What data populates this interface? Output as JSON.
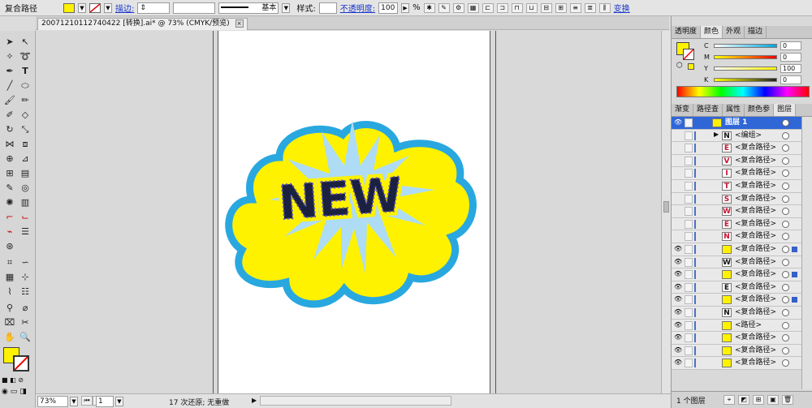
{
  "controlbar": {
    "selection_type": "复合路径",
    "stroke_label": "描边:",
    "stroke_profile": "基本",
    "style_label": "样式:",
    "opacity_label": "不透明度:",
    "opacity_value": "100",
    "opacity_unit": "%",
    "transform_label": "变换",
    "fill_color": "#fff200"
  },
  "document": {
    "tab_title": "20071210112740422 [转换].ai* @ 73% (CMYK/预览)",
    "close_glyph": "×"
  },
  "artwork": {
    "text": "NEW",
    "cloud_fill": "#fff200",
    "cloud_stroke": "#29a8e0",
    "burst_fill": "#aedcf4"
  },
  "status": {
    "zoom": "73%",
    "page": "1",
    "message": "17 次还原; 无重做"
  },
  "color_panel": {
    "tabs": [
      "透明度",
      "颜色",
      "外观",
      "描边"
    ],
    "channels": [
      {
        "label": "C",
        "value": "0"
      },
      {
        "label": "M",
        "value": "0"
      },
      {
        "label": "Y",
        "value": "100"
      },
      {
        "label": "K",
        "value": "0"
      }
    ]
  },
  "layers_panel": {
    "tabs": [
      "渐变",
      "路径查",
      "属性",
      "颜色参",
      "图层"
    ],
    "top_layer": "图层 1",
    "rows": [
      {
        "name": "<编组>",
        "glyph": "N"
      },
      {
        "name": "<复合路径>",
        "glyph": "E"
      },
      {
        "name": "<复合路径>",
        "glyph": "V"
      },
      {
        "name": "<复合路径>",
        "glyph": "I"
      },
      {
        "name": "<复合路径>",
        "glyph": "T"
      },
      {
        "name": "<复合路径>",
        "glyph": "S"
      },
      {
        "name": "<复合路径>",
        "glyph": "W"
      },
      {
        "name": "<复合路径>",
        "glyph": "E"
      },
      {
        "name": "<复合路径>",
        "glyph": "N"
      },
      {
        "name": "<复合路径>",
        "glyph": ""
      },
      {
        "name": "<复合路径>",
        "glyph": "W"
      },
      {
        "name": "<复合路径>",
        "glyph": ""
      },
      {
        "name": "<复合路径>",
        "glyph": "E"
      },
      {
        "name": "<复合路径>",
        "glyph": ""
      },
      {
        "name": "<复合路径>",
        "glyph": "N"
      },
      {
        "name": "<路径>",
        "glyph": ""
      },
      {
        "name": "<复合路径>",
        "glyph": ""
      },
      {
        "name": "<复合路径>",
        "glyph": ""
      },
      {
        "name": "<复合路径>",
        "glyph": ""
      }
    ],
    "footer_count": "1 个图层"
  }
}
